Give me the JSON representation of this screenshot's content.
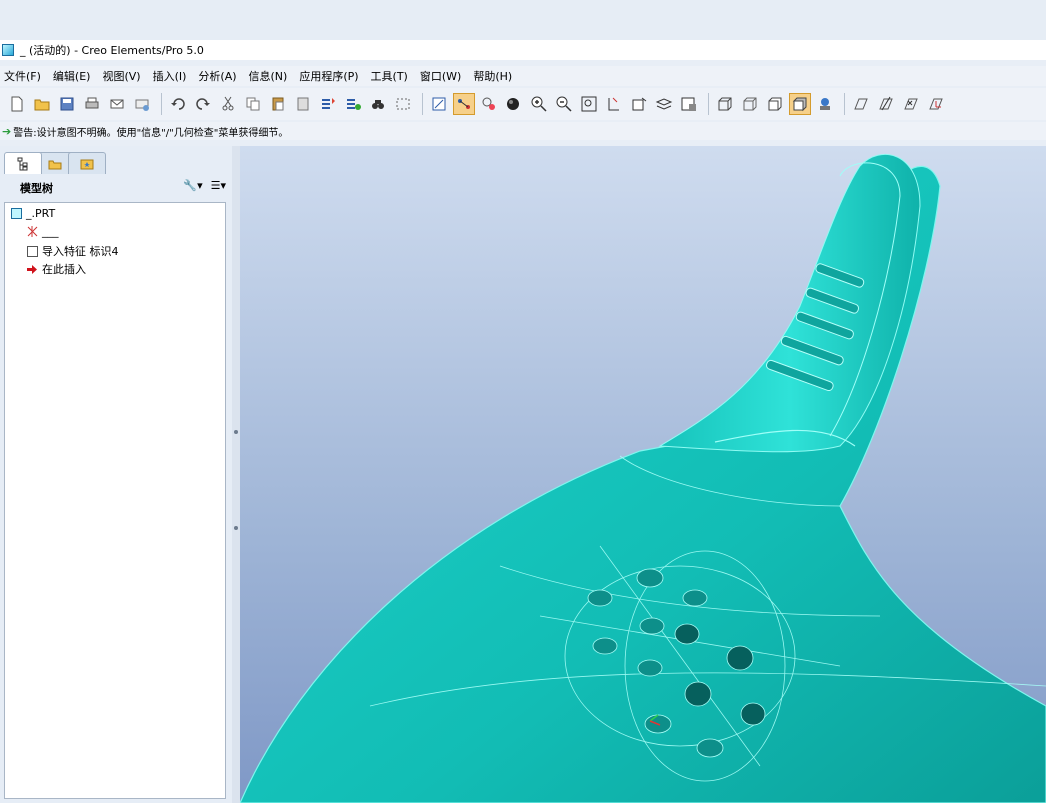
{
  "window": {
    "title": "_ (活动的) - Creo Elements/Pro 5.0"
  },
  "menu": [
    {
      "label": "文件(F)"
    },
    {
      "label": "编辑(E)"
    },
    {
      "label": "视图(V)"
    },
    {
      "label": "插入(I)"
    },
    {
      "label": "分析(A)"
    },
    {
      "label": "信息(N)"
    },
    {
      "label": "应用程序(P)"
    },
    {
      "label": "工具(T)"
    },
    {
      "label": "窗口(W)"
    },
    {
      "label": "帮助(H)"
    }
  ],
  "toolbar": {
    "icons": [
      "new-file-icon",
      "open-folder-icon",
      "save-icon",
      "print-icon",
      "email-icon",
      "email-link-icon",
      "undo-icon",
      "redo-icon",
      "cut-icon",
      "copy-icon",
      "paste-icon",
      "paste-special-icon",
      "regenerate-icon",
      "regen-manager-icon",
      "find-icon",
      "select-box-icon",
      "repaint-icon",
      "spin-center-icon",
      "orient-icon",
      "appearance-icon",
      "zoom-in-icon",
      "zoom-out-icon",
      "refit-icon",
      "reorient-icon",
      "saved-views-icon",
      "layers-icon",
      "view-manager-icon",
      "wireframe-icon",
      "hidden-line-icon",
      "no-hidden-icon",
      "shading-icon",
      "shading-edges-icon",
      "datum-planes-icon",
      "datum-axes-icon",
      "datum-points-icon",
      "csys-icon"
    ]
  },
  "status": {
    "message": "警告:设计意图不明确。使用\"信息\"/\"几何检查\"菜单获得细节。"
  },
  "model_tree": {
    "header": "模型树",
    "items": [
      {
        "label": "_.PRT"
      },
      {
        "label": "___"
      },
      {
        "label": "导入特征 标识4"
      },
      {
        "label": "在此插入"
      }
    ]
  },
  "colors": {
    "model": "#13c8c0",
    "model_edge": "#7ff6ee",
    "viewport_top": "#cfdcef",
    "viewport_bottom": "#7f98c6",
    "status_icon": "#2b9c3b",
    "insert_arrow": "#d0121b"
  }
}
